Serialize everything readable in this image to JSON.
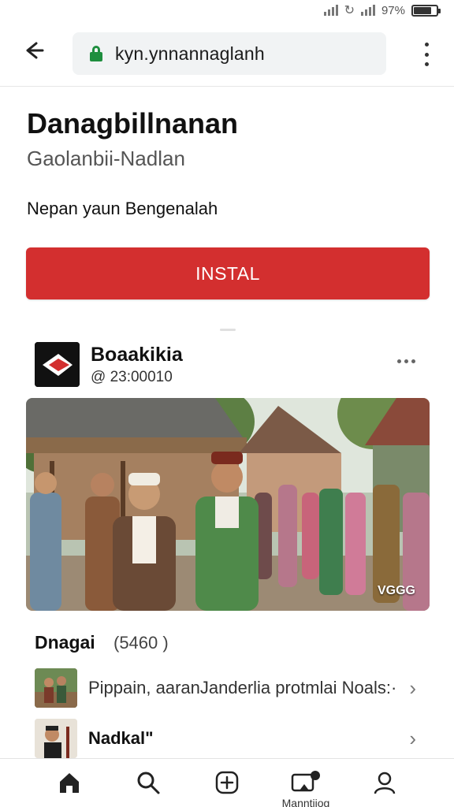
{
  "status_bar": {
    "battery": "97%"
  },
  "browser": {
    "url": "kyn.ynnannaglanh",
    "icons": [
      "back-arrow-icon",
      "lock-icon",
      "more-vertical-icon"
    ]
  },
  "app": {
    "title": "Danagbillnanan",
    "subtitle": "Gaolanbii-Nadlan",
    "description": "Nepan yaun  Bengenalah",
    "install_label": "INSTAL",
    "accent_color": "#d32f2f"
  },
  "post": {
    "author": "Boaakikia",
    "meta": "@ 23:00010",
    "image_badge": "VGGG"
  },
  "section": {
    "title": "Dnagai",
    "count": "(5460 )"
  },
  "list": [
    {
      "text": "Pippain, aaranJanderlia protmlai Noals:·",
      "thumb": "group-photo-thumb"
    },
    {
      "text": "Nadkal\"",
      "thumb": "portrait-thumb"
    }
  ],
  "bottom_nav": {
    "items": [
      "home-icon",
      "search-icon",
      "create-icon",
      "media-icon",
      "profile-icon"
    ],
    "active_label": "Manntiiog"
  }
}
